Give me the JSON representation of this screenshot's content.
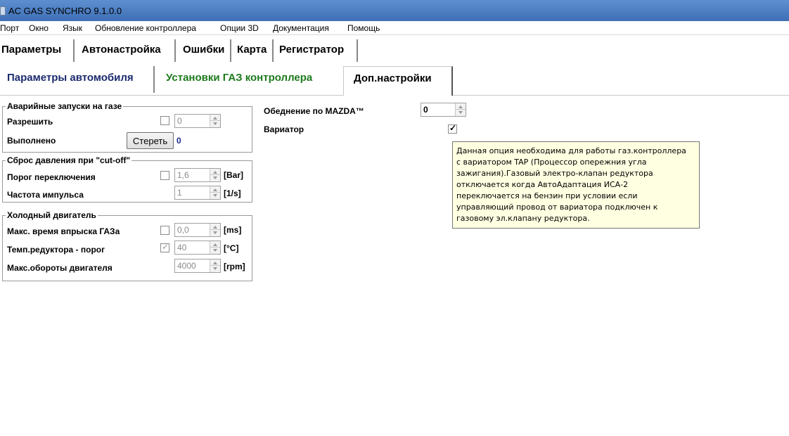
{
  "window": {
    "title": "AC GAS SYNCHRO  9.1.0.0"
  },
  "menu": [
    "Порт",
    "Окно",
    "Язык",
    "Обновление контроллера",
    "Опции 3D",
    "Документация",
    "Помощь"
  ],
  "main_tabs": [
    "Параметры",
    "Автонастройка",
    "Ошибки",
    "Карта",
    "Регистратор"
  ],
  "sub_tabs": [
    "Параметры автомобиля",
    "Установки ГАЗ контроллера",
    "Доп.настройки"
  ],
  "colors": {
    "sub_tab_1": "#1c2a6e",
    "sub_tab_2": "#1e7a1e",
    "sub_tab_3": "#000000",
    "tooltip_bg": "#ffffe1"
  },
  "emergency": {
    "legend": "Аварийные запуски на газе",
    "enable_label": "Разрешить",
    "enable_value": "0",
    "done_label": "Выполнено",
    "erase_button": "Стереть",
    "done_count": "0"
  },
  "cutoff": {
    "legend": "Сброс давления при \"cut-off\"",
    "threshold_label": "Порог переключения",
    "threshold_value": "1,6",
    "threshold_unit": "[Bar]",
    "pulse_label": "Частота импульса",
    "pulse_value": "1",
    "pulse_unit": "[1/s]"
  },
  "cold_engine": {
    "legend": "Холодный двигатель",
    "max_injection_label": "Макс. время впрыска ГАЗа",
    "max_injection_value": "0,0",
    "max_injection_unit": "[ms]",
    "reducer_temp_label": "Темп.редуктора - порог",
    "reducer_temp_value": "40",
    "reducer_temp_unit": "[°C]",
    "max_rpm_label": "Макс.обороты двигателя",
    "max_rpm_value": "4000",
    "max_rpm_unit": "[rpm]"
  },
  "mazda": {
    "label": "Обеднение по MAZDA™",
    "value": "0"
  },
  "variator": {
    "label": "Вариатор",
    "checked": true
  },
  "tooltip": {
    "lines": [
      "Данная опция необходима для работы газ.контроллера",
      "с вариатором TAP (Процессор опережния угла",
      "зажигания).Газовый электро-клапан редуктора",
      "отключается когда АвтоАдаптация ИСА-2",
      "переключается на бензин при условии если",
      "управляющий провод от вариатора подключен к",
      "газовому эл.клапану редуктора."
    ]
  }
}
